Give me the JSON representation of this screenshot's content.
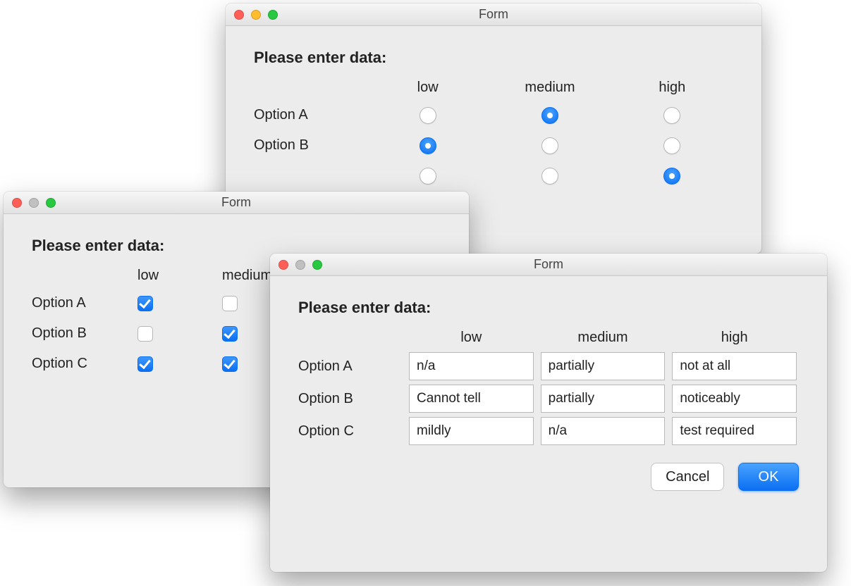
{
  "common": {
    "window_title": "Form",
    "heading": "Please enter data:",
    "columns": {
      "low": "low",
      "medium": "medium",
      "high": "high"
    },
    "rows": {
      "a": "Option A",
      "b": "Option B",
      "c": "Option C"
    },
    "buttons": {
      "cancel": "Cancel",
      "ok": "OK"
    }
  },
  "radio_window": {
    "selections": {
      "a": "medium",
      "b": "low",
      "c": "high"
    }
  },
  "checkbox_window": {
    "checks": {
      "a": {
        "low": true,
        "medium": false
      },
      "b": {
        "low": false,
        "medium": true
      },
      "c": {
        "low": true,
        "medium": true
      }
    }
  },
  "text_window": {
    "values": {
      "a": {
        "low": "n/a",
        "medium": "partially",
        "high": "not at all"
      },
      "b": {
        "low": "Cannot tell",
        "medium": "partially",
        "high": "noticeably"
      },
      "c": {
        "low": "mildly",
        "medium": "n/a",
        "high": "test required"
      }
    }
  }
}
